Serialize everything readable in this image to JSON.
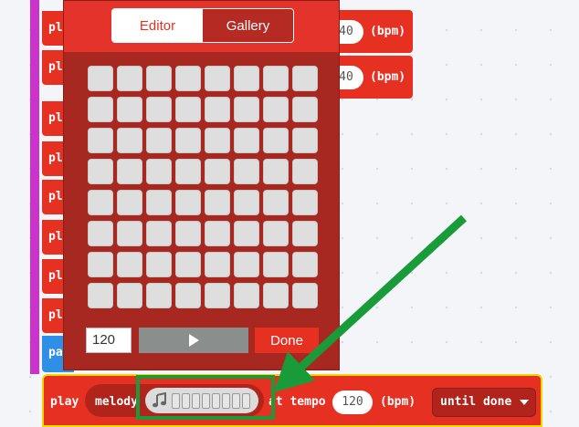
{
  "blocks": {
    "left_labels": [
      "pl",
      "pl",
      "pl",
      "pl",
      "pl",
      "pl",
      "pl",
      "pl",
      "pa"
    ],
    "top_blocks": [
      {
        "tempo": "40",
        "unit": "(bpm)"
      },
      {
        "tempo": "40",
        "unit": "(bpm)"
      }
    ]
  },
  "editor": {
    "tabs": {
      "editor": "Editor",
      "gallery": "Gallery"
    },
    "grid": {
      "rows": 8,
      "cols": 8
    },
    "tempo_value": "120",
    "play_icon": "play-triangle-icon",
    "done_label": "Done"
  },
  "play_block": {
    "play_label": "play",
    "melody_label": "melody",
    "melody_icon": "music-note-icon",
    "at_tempo_label": "at tempo",
    "tempo_value": "120",
    "bpm_label": "(bpm)",
    "mode_label": "until done",
    "mode_icon": "caret-down-icon"
  },
  "annotation": {
    "arrow_color": "#1a9b3a",
    "highlight_color": "#1a9b3a"
  },
  "colors": {
    "block_red": "#e63022",
    "popup_dark_red": "#a62821",
    "stack_magenta": "#cc33cc",
    "selection_yellow": "#f2d600"
  }
}
